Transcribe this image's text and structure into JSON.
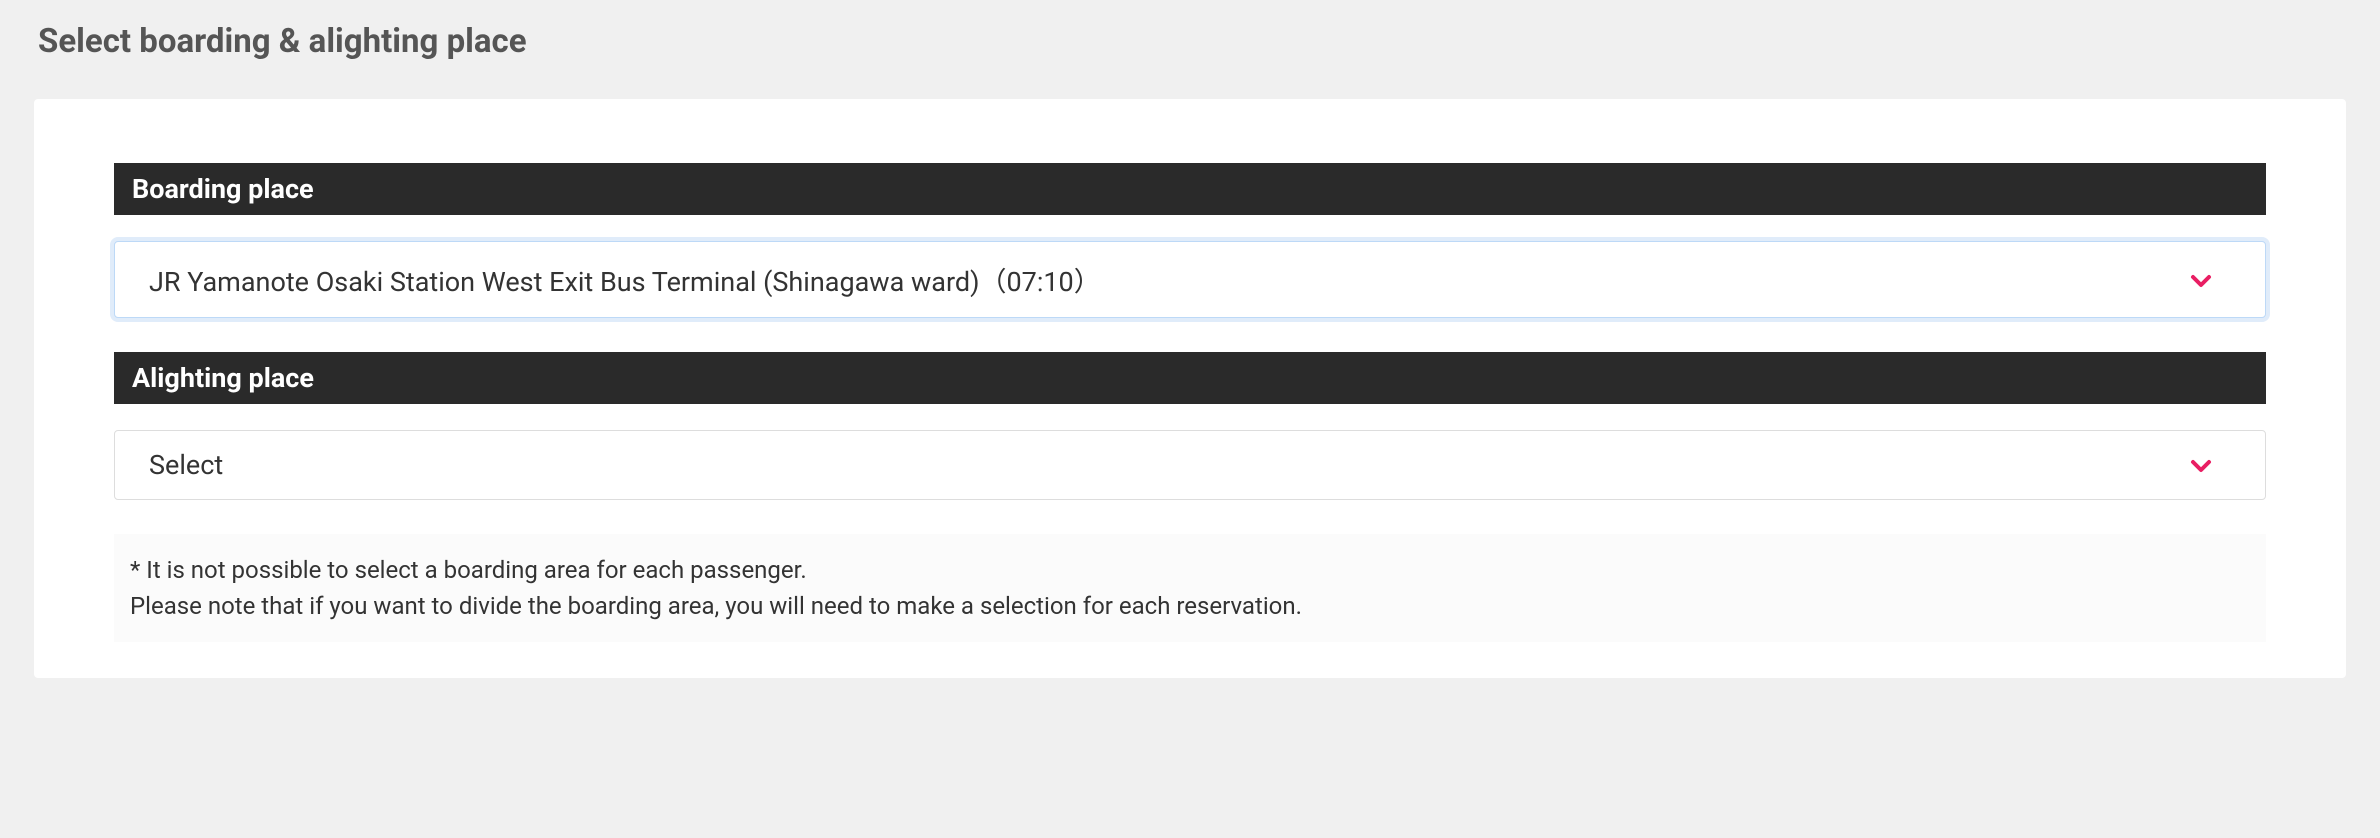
{
  "page": {
    "title": "Select boarding & alighting place"
  },
  "boarding": {
    "header": "Boarding place",
    "selected": "JR Yamanote Osaki Station West Exit Bus Terminal (Shinagawa ward)（07:10）"
  },
  "alighting": {
    "header": "Alighting place",
    "selected": "Select"
  },
  "note": {
    "line1": "* It is not possible to select a boarding area for each passenger.",
    "line2": "Please note that if you want to divide the boarding area, you will need to make a selection for each reservation."
  },
  "colors": {
    "accent": "#e91e63"
  }
}
